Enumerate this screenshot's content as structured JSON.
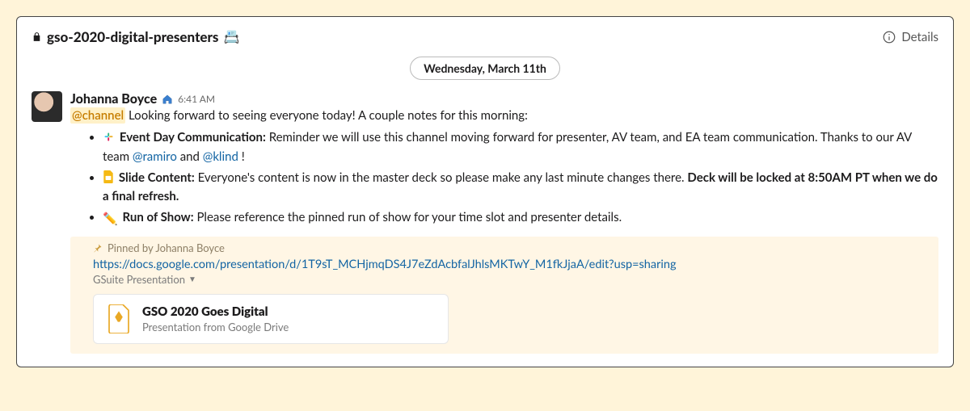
{
  "header": {
    "channel_name": "gso-2020-digital-presenters",
    "details_label": "Details"
  },
  "date_divider": "Wednesday, March 11th",
  "message": {
    "user": "Johanna Boyce",
    "time": "6:41 AM",
    "channel_mention": "@channel",
    "greeting": "Looking forward to seeing everyone today! A couple notes for this morning:",
    "bullets": {
      "b1": {
        "title": "Event Day Communication:",
        "text_a": "Reminder we will use this channel moving forward for presenter, AV team, and EA team communication. Thanks to our AV team ",
        "mention1": "@ramiro",
        "mid": " and ",
        "mention2": "@klind",
        "tail": "!"
      },
      "b2": {
        "title": "Slide Content:",
        "text_a": "Everyone's content is now in the master deck so please make any last minute changes there. ",
        "strong_tail": "Deck will be locked at 8:50AM PT when we do a final refresh."
      },
      "b3": {
        "title": "Run of Show:",
        "text_a": "Please reference the pinned run of show for your time slot and presenter details."
      }
    }
  },
  "pinned": {
    "by_text": "Pinned by Johanna Boyce",
    "url": "https://docs.google.com/presentation/d/1T9sT_MCHjmqDS4J7eZdAcbfalJhlsMKTwY_M1fkJjaA/edit?usp=sharing",
    "source_label": "GSuite Presentation",
    "attachment": {
      "title": "GSO 2020 Goes Digital",
      "subtitle": "Presentation from Google Drive"
    }
  }
}
